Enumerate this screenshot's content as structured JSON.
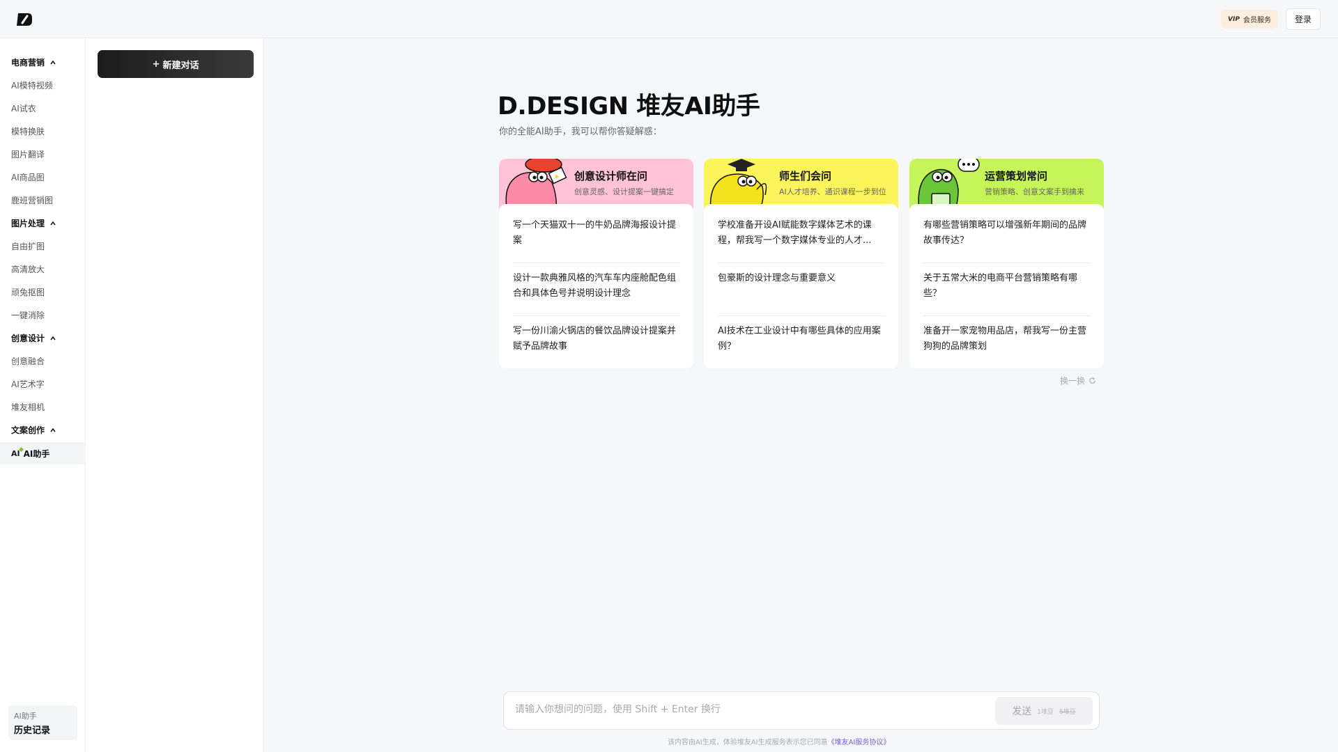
{
  "header": {
    "vip_tag": "VIP",
    "vip_label": "会员服务",
    "login_label": "登录"
  },
  "sidebar": {
    "sections": [
      {
        "title": "电商营销",
        "items": [
          "AI模特视频",
          "AI试衣",
          "模特换肤",
          "图片翻译",
          "AI商品图",
          "鹿班营销图"
        ]
      },
      {
        "title": "图片处理",
        "items": [
          "自由扩图",
          "高清放大",
          "顽兔抠图",
          "一键消除"
        ]
      },
      {
        "title": "创意设计",
        "items": [
          "创意融合",
          "AI艺术字",
          "堆友相机"
        ]
      },
      {
        "title": "文案创作",
        "items": []
      }
    ],
    "active_item": {
      "badge": "AI",
      "label": "AI助手"
    },
    "history": {
      "small": "AI助手",
      "big": "历史记录"
    }
  },
  "panel2": {
    "new_chat_plus": "+",
    "new_chat_label": "新建对话"
  },
  "main": {
    "title": "D.DESIGN 堆友AI助手",
    "subtitle": "你的全能AI助手，我可以帮你答疑解惑：",
    "cards": [
      {
        "title": "创意设计师在问",
        "subtitle": "创意灵感、设计提案一键搞定",
        "color": "#ffc2d6",
        "mascot": "pink-beret-mascot",
        "questions": [
          "写一个天猫双十一的牛奶品牌海报设计提案",
          "设计一款典雅风格的汽车车内座舱配色组合和具体色号并说明设计理念",
          "写一份川渝火锅店的餐饮品牌设计提案并赋予品牌故事"
        ]
      },
      {
        "title": "师生们会问",
        "subtitle": "AI人才培养、通识课程一步到位",
        "color": "#fbf45a",
        "mascot": "yellow-graduate-mascot",
        "questions": [
          "学校准备开设AI赋能数字媒体艺术的课程，帮我写一个数字媒体专业的人才...",
          "包豪斯的设计理念与重要意义",
          "AI技术在工业设计中有哪些具体的应用案例？"
        ]
      },
      {
        "title": "运营策划常问",
        "subtitle": "营销策略、创意文案手到擒来",
        "color": "#c6f55a",
        "mascot": "green-chat-mascot",
        "questions": [
          "有哪些营销策略可以增强新年期间的品牌故事传达？",
          "关于五常大米的电商平台营销策略有哪些？",
          "准备开一家宠物用品店，帮我写一份主营狗狗的品牌策划"
        ]
      }
    ],
    "refresh_label": "换一换"
  },
  "input": {
    "placeholder": "请输入你想问的问题，使用 Shift + Enter 换行",
    "send_label": "发送",
    "cost_now": "1堆豆",
    "cost_old": "5堆豆"
  },
  "footer": {
    "text": "该内容由AI生成，体验堆友AI生成服务表示您已同意",
    "link": "《堆友AI服务协议》"
  }
}
